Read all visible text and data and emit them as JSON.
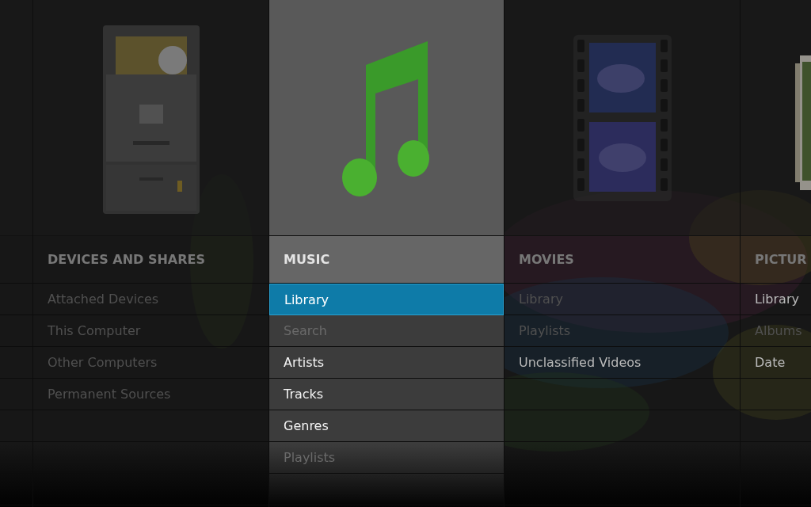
{
  "columns": [
    {
      "title": "DEVICES AND SHARES",
      "kind": "cabinet",
      "selected": false,
      "items": [
        {
          "label": "Attached Devices",
          "disabled": true,
          "selected": false
        },
        {
          "label": "This Computer",
          "disabled": true,
          "selected": false
        },
        {
          "label": "Other Computers",
          "disabled": true,
          "selected": false
        },
        {
          "label": "Permanent Sources",
          "disabled": true,
          "selected": false
        }
      ]
    },
    {
      "title": "MUSIC",
      "kind": "note",
      "selected": true,
      "items": [
        {
          "label": "Library",
          "disabled": false,
          "selected": true
        },
        {
          "label": "Search",
          "disabled": true,
          "selected": false
        },
        {
          "label": "Artists",
          "disabled": false,
          "selected": false
        },
        {
          "label": "Tracks",
          "disabled": false,
          "selected": false
        },
        {
          "label": "Genres",
          "disabled": false,
          "selected": false
        },
        {
          "label": "Playlists",
          "disabled": true,
          "selected": false
        }
      ]
    },
    {
      "title": "MOVIES",
      "kind": "film",
      "selected": false,
      "items": [
        {
          "label": "Library",
          "disabled": true,
          "selected": false
        },
        {
          "label": "Playlists",
          "disabled": true,
          "selected": false
        },
        {
          "label": "Unclassified Videos",
          "disabled": false,
          "selected": false
        }
      ]
    },
    {
      "title": "PICTUR",
      "kind": "photos",
      "selected": false,
      "items": [
        {
          "label": "Library",
          "disabled": false,
          "selected": false
        },
        {
          "label": "Albums",
          "disabled": true,
          "selected": false
        },
        {
          "label": "Date",
          "disabled": false,
          "selected": false
        }
      ]
    }
  ]
}
